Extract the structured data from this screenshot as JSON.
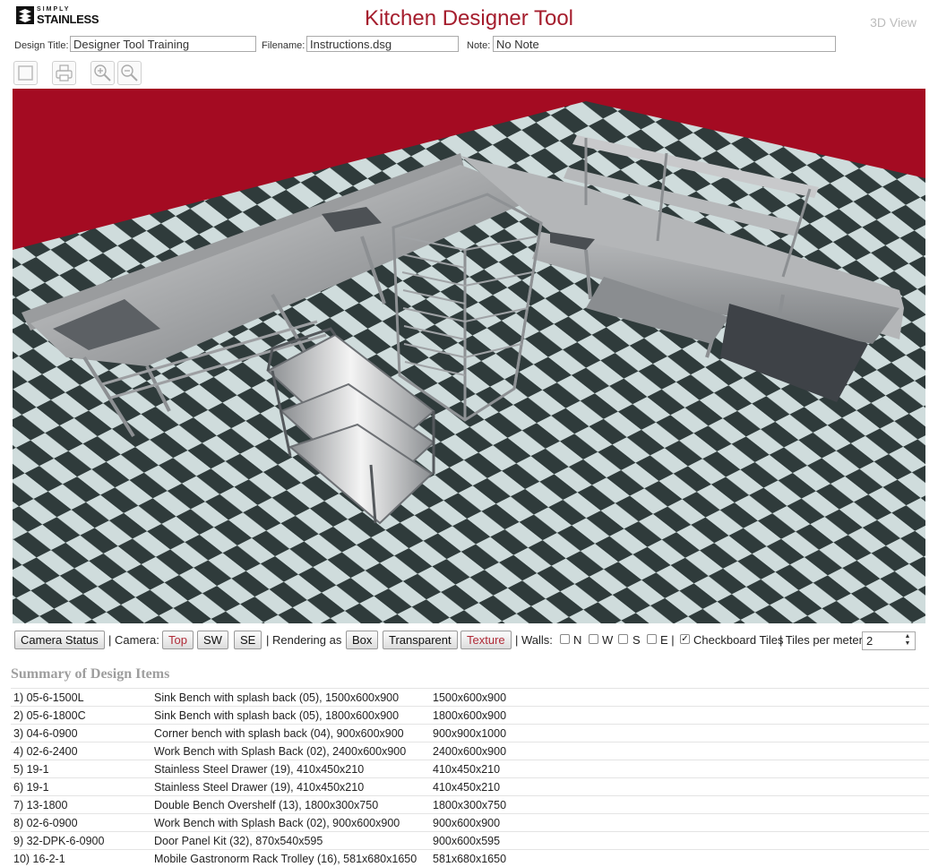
{
  "header": {
    "logo_small": "SIMPLY",
    "logo_main": "STAINLESS",
    "title": "Kitchen Designer Tool",
    "view_label": "3D View"
  },
  "meta": {
    "design_title_label": "Design Title:",
    "design_title_value": "Designer Tool Training",
    "filename_label": "Filename:",
    "filename_value": "Instructions.dsg",
    "note_label": "Note:",
    "note_value": "No Note"
  },
  "toolbar": {
    "icons": [
      "blank-icon",
      "print-icon",
      "zoom-in-icon",
      "zoom-out-icon"
    ]
  },
  "viewport": {
    "wall_color": "#a40b22",
    "tile_dark": "#2f3b3b",
    "tile_light": "#cfdcdc"
  },
  "controls": {
    "camera_status": "Camera Status",
    "camera_label": "| Camera:",
    "camera_top": "Top",
    "camera_sw": "SW",
    "camera_se": "SE",
    "rendering_label": "| Rendering as",
    "render_box": "Box",
    "render_transparent": "Transparent",
    "render_texture": "Texture",
    "walls_label": "| Walls:",
    "wall_n": "N",
    "wall_w": "W",
    "wall_s": "S",
    "wall_e": "E |",
    "checkboard_label": "Checkboard Tiles",
    "checkboard_checked": true,
    "tiles_label": "| Tiles per meter",
    "tiles_value": "2"
  },
  "summary": {
    "title": "Summary of Design Items",
    "items": [
      {
        "code": "1) 05-6-1500L",
        "desc": "Sink Bench with splash back (05), 1500x600x900",
        "size": "1500x600x900"
      },
      {
        "code": "2) 05-6-1800C",
        "desc": "Sink Bench with splash back (05), 1800x600x900",
        "size": "1800x600x900"
      },
      {
        "code": "3) 04-6-0900",
        "desc": "Corner bench with splash back (04), 900x600x900",
        "size": "900x900x1000"
      },
      {
        "code": "4) 02-6-2400",
        "desc": "Work Bench with Splash Back (02), 2400x600x900",
        "size": "2400x600x900"
      },
      {
        "code": "5) 19-1",
        "desc": "Stainless Steel Drawer (19), 410x450x210",
        "size": "410x450x210"
      },
      {
        "code": "6) 19-1",
        "desc": "Stainless Steel Drawer (19), 410x450x210",
        "size": "410x450x210"
      },
      {
        "code": "7) 13-1800",
        "desc": "Double Bench Overshelf (13), 1800x300x750",
        "size": "1800x300x750"
      },
      {
        "code": "8) 02-6-0900",
        "desc": "Work Bench with Splash Back (02), 900x600x900",
        "size": "900x600x900"
      },
      {
        "code": "9) 32-DPK-6-0900",
        "desc": "Door Panel Kit (32), 870x540x595",
        "size": "900x600x595"
      },
      {
        "code": "10) 16-2-1",
        "desc": "Mobile Gastronorm Rack Trolley (16), 581x680x1650",
        "size": "581x680x1650"
      }
    ]
  }
}
